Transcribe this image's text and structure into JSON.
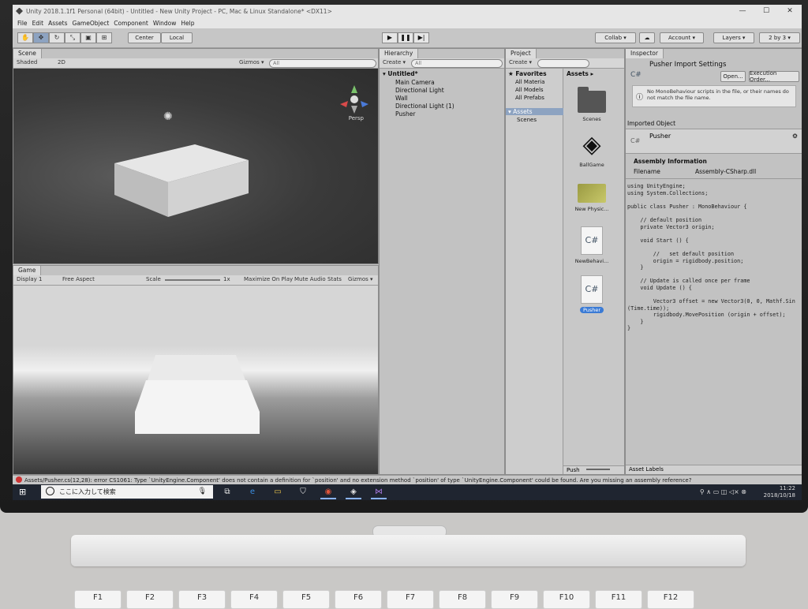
{
  "window": {
    "title": "Unity 2018.1.1f1 Personal (64bit) - Untitled - New Unity Project - PC, Mac & Linux Standalone* <DX11>",
    "controls": [
      "—",
      "☐",
      "✕"
    ]
  },
  "menu": [
    "File",
    "Edit",
    "Assets",
    "GameObject",
    "Component",
    "Window",
    "Help"
  ],
  "toolbar": {
    "pivot": "Center",
    "space": "Local",
    "collab": "Collab ▾",
    "account": "Account ▾",
    "layers": "Layers ▾",
    "layout": "2 by 3 ▾"
  },
  "scene": {
    "tab": "Scene",
    "shading": "Shaded",
    "mode_2d": "2D",
    "gizmos": "Gizmos ▾",
    "search_placeholder": "All",
    "persp": "Persp"
  },
  "game": {
    "tab": "Game",
    "display": "Display 1",
    "aspect": "Free Aspect",
    "scale_label": "Scale",
    "scale_value": "1x",
    "maximize": "Maximize On Play",
    "mute": "Mute Audio",
    "stats": "Stats",
    "gizmos": "Gizmos ▾"
  },
  "hierarchy": {
    "tab": "Hierarchy",
    "create": "Create ▾",
    "search_placeholder": "All",
    "scene_name": "Untitled*",
    "items": [
      "Main Camera",
      "Directional Light",
      "Wall",
      "Directional Light (1)",
      "Pusher"
    ]
  },
  "project": {
    "tab": "Project",
    "create": "Create ▾",
    "favorites": "Favorites",
    "favorite_items": [
      "All Materia",
      "All Models",
      "All Prefabs"
    ],
    "assets_root": "Assets",
    "asset_folders": [
      "Scenes"
    ],
    "breadcrumb": "Assets ▸",
    "assets": [
      "Scenes",
      "BallGame",
      "New Physic...",
      "NewBehavi...",
      "Pusher"
    ],
    "footer": "Push"
  },
  "inspector": {
    "tab": "Inspector",
    "title": "Pusher Import Settings",
    "open": "Open...",
    "exec_order": "Execution Order...",
    "warning": "No MonoBehaviour scripts in the file, or their names do not match the file name.",
    "imported_object": "Imported Object",
    "object_name": "Pusher",
    "assembly_heading": "Assembly Information",
    "filename_label": "Filename",
    "filename_value": "Assembly-CSharp.dll",
    "code": "using UnityEngine;\nusing System.Collections;\n\npublic class Pusher : MonoBehaviour {\n\n    // default position\n    private Vector3 origin;\n\n    void Start () {\n\n        //   set default position\n        origin = rigidbody.position;\n    }\n\n    // Update is called once per frame\n    void Update () {\n\n        Vector3 offset = new Vector3(0, 0, Mathf.Sin\n(Time.time));\n        rigidbody.MovePosition (origin + offset);\n    }\n}",
    "asset_labels": "Asset Labels"
  },
  "console": {
    "error": "Assets/Pusher.cs(12,28): error CS1061: Type `UnityEngine.Component' does not contain a definition for `position' and no extension method `position' of type `UnityEngine.Component' could be found. Are you missing an assembly reference?"
  },
  "taskbar": {
    "search_placeholder": "ここに入力して検索",
    "time": "11:22",
    "date": "2018/10/18"
  },
  "keyboard": [
    "F1",
    "F2",
    "F3",
    "F4",
    "F5",
    "F6",
    "F7",
    "F8",
    "F9",
    "F10",
    "F11",
    "F12"
  ]
}
